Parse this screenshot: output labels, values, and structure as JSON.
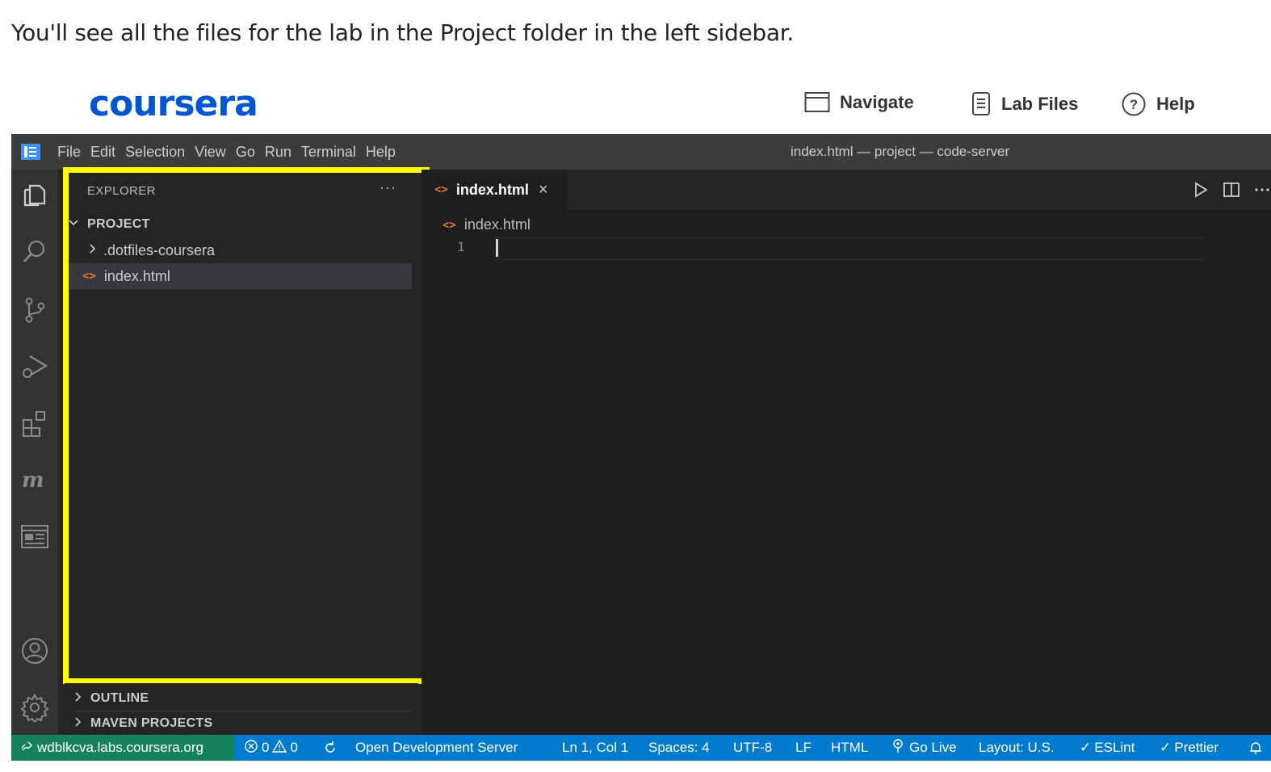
{
  "intro_text": "You'll see all the files for the lab in the Project folder in the left sidebar.",
  "header": {
    "logo": "coursera",
    "links": [
      {
        "label": "Navigate",
        "icon": "window-icon"
      },
      {
        "label": "Lab Files",
        "icon": "document-icon"
      },
      {
        "label": "Help",
        "icon": "question-circle-icon"
      }
    ]
  },
  "ide": {
    "menu": [
      "File",
      "Edit",
      "Selection",
      "View",
      "Go",
      "Run",
      "Terminal",
      "Help"
    ],
    "window_title": "index.html — project — code-server",
    "activity_bar": [
      "files-icon",
      "search-icon",
      "source-control-icon",
      "run-debug-icon",
      "extensions-icon",
      "maven-icon",
      "preview-icon",
      "account-icon",
      "settings-gear-icon"
    ],
    "explorer": {
      "title": "EXPLORER",
      "more": "···",
      "project_label": "PROJECT",
      "items": [
        {
          "name": ".dotfiles-coursera",
          "kind": "folder"
        },
        {
          "name": "index.html",
          "kind": "file",
          "selected": true
        }
      ],
      "bottom_sections": [
        "OUTLINE",
        "MAVEN PROJECTS"
      ]
    },
    "editor": {
      "tab_label": "index.html",
      "tab_close": "×",
      "breadcrumb": "index.html",
      "line_number": "1"
    },
    "status_bar": {
      "remote": "wdblkcva.labs.coursera.org",
      "errors": "0",
      "warnings": "0",
      "open_dev_server": "Open Development Server",
      "position": "Ln 1, Col 1",
      "spaces": "Spaces: 4",
      "encoding": "UTF-8",
      "eol": "LF",
      "language": "HTML",
      "go_live": "Go Live",
      "layout": "Layout: U.S.",
      "eslint": "ESLint",
      "prettier": "Prettier"
    },
    "colors": {
      "highlight": "#ffff00",
      "status_bar": "#007acc",
      "remote": "#16825d",
      "logo": "#0056d2"
    }
  }
}
